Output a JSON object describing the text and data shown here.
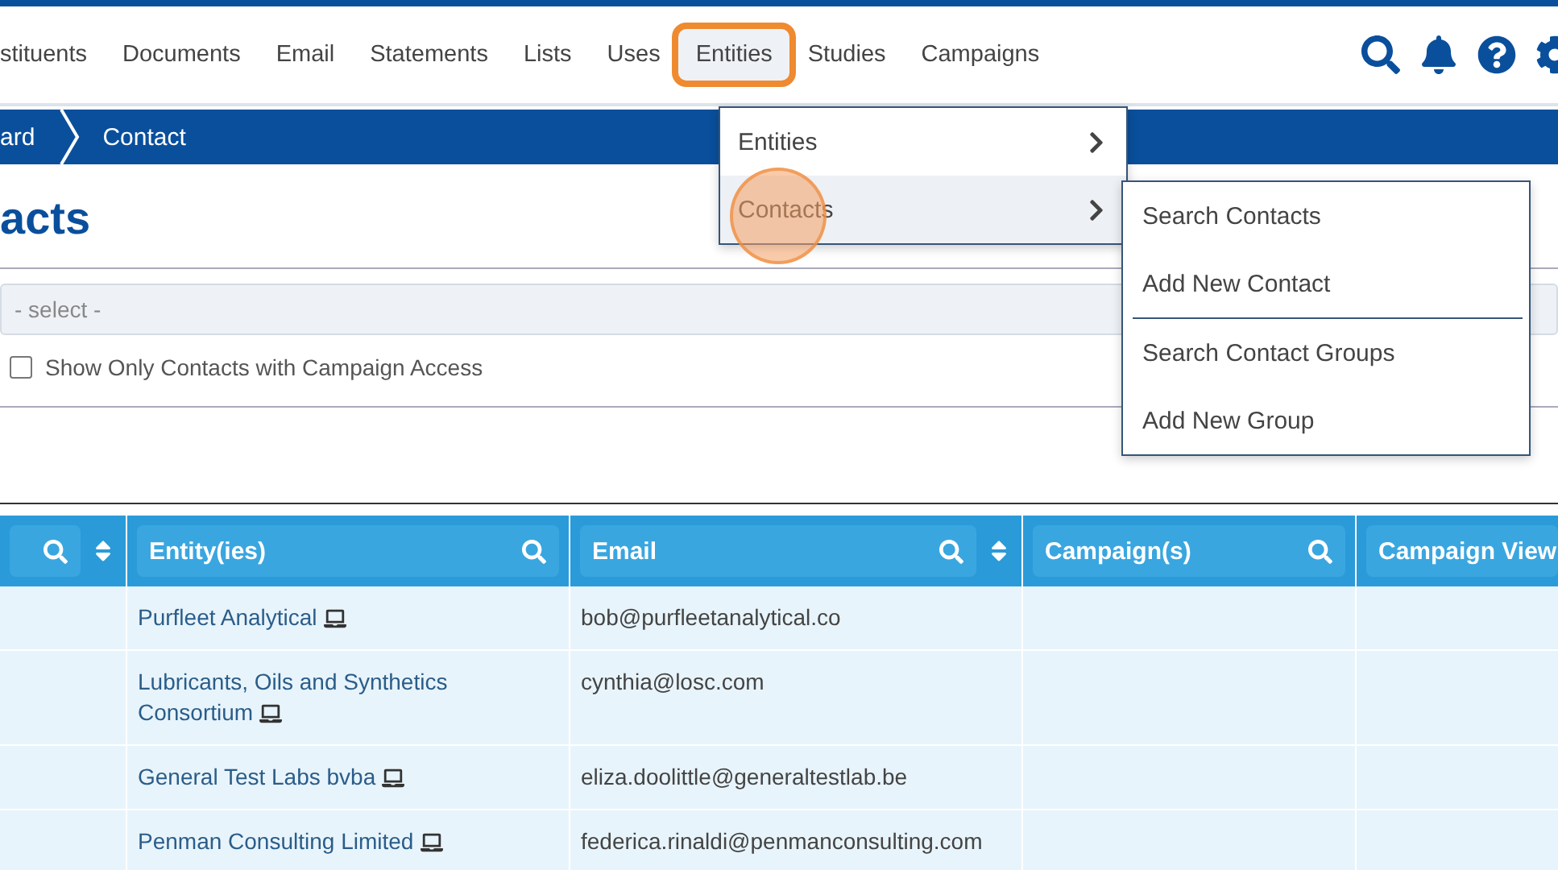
{
  "nav": {
    "items": [
      {
        "label": "stituents",
        "selected": false
      },
      {
        "label": "Documents",
        "selected": false
      },
      {
        "label": "Email",
        "selected": false
      },
      {
        "label": "Statements",
        "selected": false
      },
      {
        "label": "Lists",
        "selected": false
      },
      {
        "label": "Uses",
        "selected": false
      },
      {
        "label": "Entities",
        "selected": true
      },
      {
        "label": "Studies",
        "selected": false
      },
      {
        "label": "Campaigns",
        "selected": false
      }
    ]
  },
  "breadcrumb": [
    "ard",
    "Contact"
  ],
  "title": "acts",
  "filter": {
    "placeholder": "- select -",
    "checkbox": {
      "label": "Show Only Contacts with Campaign Access",
      "checked": false
    }
  },
  "table": {
    "columns": [
      {
        "sortable": true
      },
      {
        "label": "Entity(ies)",
        "sortable": false
      },
      {
        "label": "Email",
        "sortable": true
      },
      {
        "label": "Campaign(s)",
        "sortable": false
      },
      {
        "label": "Campaign View",
        "sortable": false
      }
    ],
    "rows": [
      {
        "entity": "Purfleet Analytical",
        "email": "bob@purfleetanalytical.co"
      },
      {
        "entity": "Lubricants, Oils and Synthetics Consortium",
        "email": "cynthia@losc.com"
      },
      {
        "entity": "General Test Labs bvba",
        "email": "eliza.doolittle@generaltestlab.be"
      },
      {
        "entity": "Penman Consulting Limited",
        "email": "federica.rinaldi@penmanconsulting.com"
      }
    ]
  },
  "menu": {
    "items": [
      {
        "label": "Entities",
        "selected": false
      },
      {
        "label": "Contacts",
        "selected": true
      }
    ]
  },
  "submenu": {
    "groups": [
      [
        "Search Contacts",
        "Add New Contact"
      ],
      [
        "Search Contact Groups",
        "Add New Group"
      ]
    ]
  }
}
